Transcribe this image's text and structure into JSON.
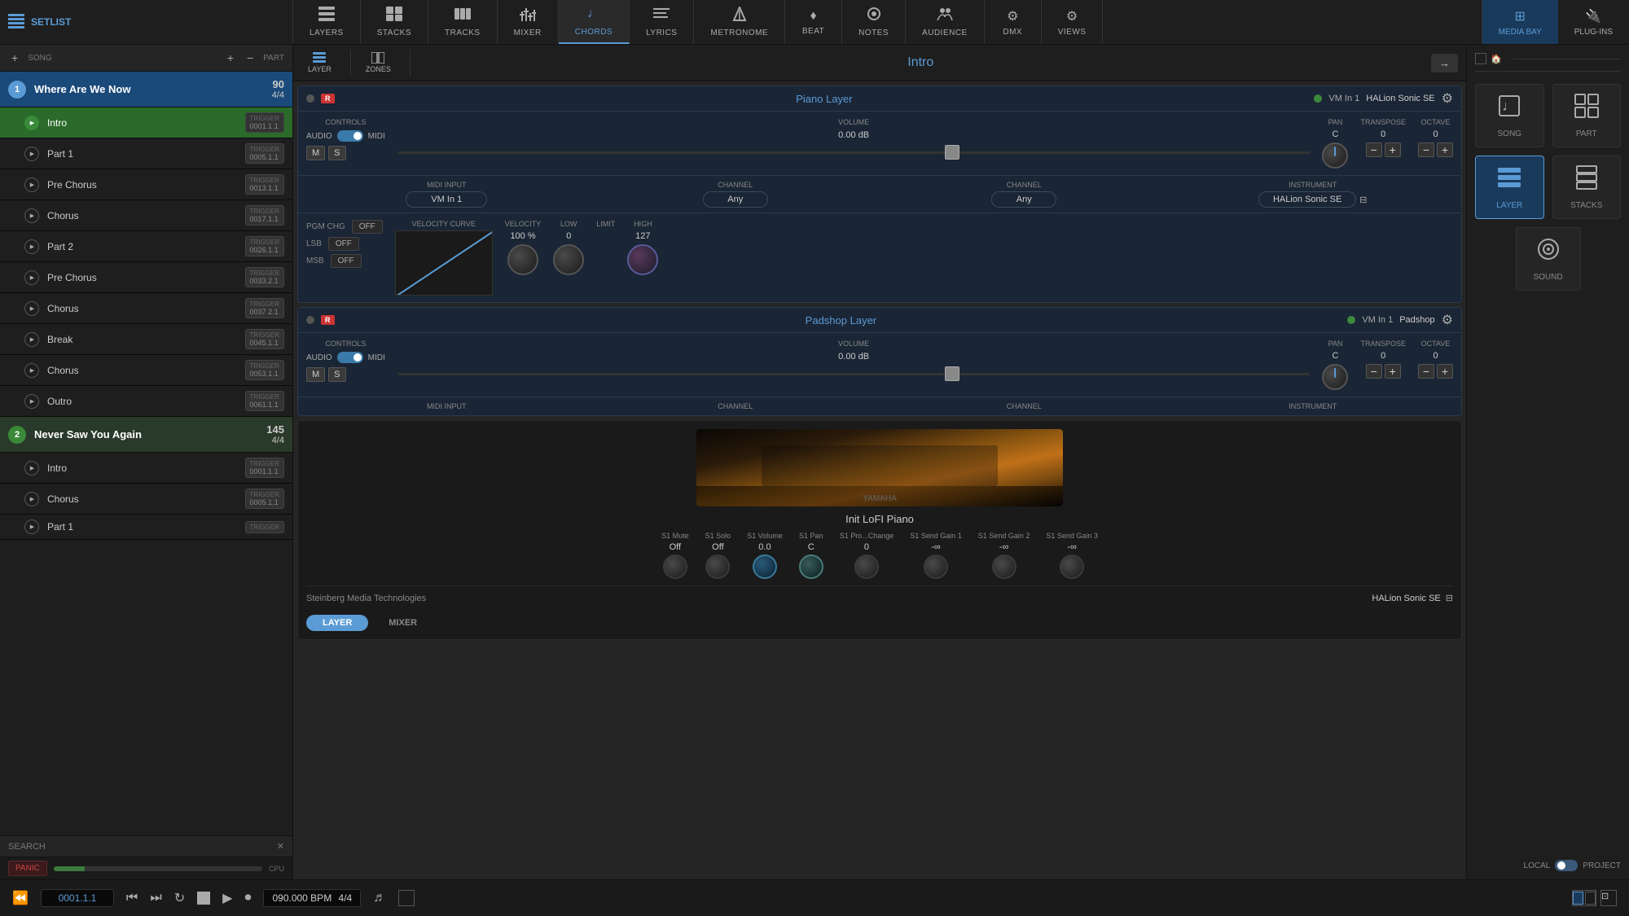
{
  "app": {
    "title": "Steinberg Media Technologies"
  },
  "topNav": {
    "setlist": "SETLIST",
    "tabs": [
      {
        "id": "layers",
        "label": "LAYERS",
        "icon": "⊞",
        "active": false
      },
      {
        "id": "stacks",
        "label": "STACKS",
        "icon": "⧉",
        "active": false
      },
      {
        "id": "tracks",
        "label": "TRACKS",
        "icon": "⊟",
        "active": false
      },
      {
        "id": "mixer",
        "label": "MIXER",
        "icon": "⊞",
        "active": false
      },
      {
        "id": "chords",
        "label": "CHORDS",
        "icon": "♩",
        "active": false
      },
      {
        "id": "lyrics",
        "label": "LYRICS",
        "icon": "≡",
        "active": false
      },
      {
        "id": "metronome",
        "label": "METRONOME",
        "icon": "🎵",
        "active": false
      },
      {
        "id": "beat",
        "label": "BEAT",
        "icon": "♦",
        "active": false
      },
      {
        "id": "notes",
        "label": "NOTES",
        "icon": "👤",
        "active": false
      },
      {
        "id": "audience",
        "label": "AUDIENCE",
        "icon": "👥",
        "active": false
      },
      {
        "id": "dmx",
        "label": "DMX",
        "icon": "⚙",
        "active": false
      },
      {
        "id": "views",
        "label": "VIEWS",
        "icon": "⚙",
        "active": false
      }
    ],
    "mediaBay": "MEDIA BAY",
    "plugIns": "PLUG-INS"
  },
  "sidebar": {
    "addSongLabel": "+",
    "addPartLabel": "+",
    "removeSongLabel": "−",
    "removePartLabel": "−",
    "songLabel": "SONG",
    "partLabel": "PART",
    "songs": [
      {
        "id": 1,
        "number": "1",
        "title": "Where Are We Now",
        "bpm": "90",
        "time": "4/4",
        "active": true,
        "parts": [
          {
            "name": "Intro",
            "trigger": "0001.1.1",
            "active": true
          },
          {
            "name": "Part 1",
            "trigger": "0005.1.1",
            "active": false
          },
          {
            "name": "Pre Chorus",
            "trigger": "0013.1.1",
            "active": false
          },
          {
            "name": "Chorus",
            "trigger": "0017.1.1",
            "active": false
          },
          {
            "name": "Part 2",
            "trigger": "0026.1.1",
            "active": false
          },
          {
            "name": "Pre Chorus",
            "trigger": "0033.2.1",
            "active": false
          },
          {
            "name": "Chorus",
            "trigger": "0037.2.1",
            "active": false
          },
          {
            "name": "Break",
            "trigger": "0045.1.1",
            "active": false
          },
          {
            "name": "Chorus",
            "trigger": "0053.1.1",
            "active": false
          },
          {
            "name": "Outro",
            "trigger": "0061.1.1",
            "active": false
          }
        ]
      },
      {
        "id": 2,
        "number": "2",
        "title": "Never Saw You Again",
        "bpm": "145",
        "time": "4/4",
        "active": false,
        "parts": [
          {
            "name": "Intro",
            "trigger": "0001.1.1",
            "active": false
          },
          {
            "name": "Chorus",
            "trigger": "0005.1.1",
            "active": false
          },
          {
            "name": "Part 1",
            "trigger": "",
            "active": false
          }
        ]
      }
    ],
    "searchLabel": "SEARCH",
    "panicLabel": "PANIC",
    "cpuLabel": "CPU"
  },
  "centerPanel": {
    "layerLabel": "LAYER",
    "zonesLabel": "ZONES",
    "sectionName": "Intro",
    "layers": [
      {
        "name": "Piano Layer",
        "rBtn": "R",
        "statusColor": "#3a8a3a",
        "vmInput": "VM In 1",
        "instrument": "HALion Sonic SE",
        "controls": {
          "audioLabel": "AUDIO",
          "midiLabel": "MIDI",
          "volumeLabel": "VOLUME",
          "volumeValue": "0.00 dB",
          "panLabel": "PAN",
          "panValue": "C",
          "transposeLabel": "TRANSPOSE",
          "transposeValue": "0",
          "octaveLabel": "OCTAVE",
          "octaveValue": "0"
        },
        "midiInput": {
          "midiInputLabel": "MIDI INPUT",
          "midiInputValue": "VM In 1",
          "channelLabel": "CHANNEL",
          "channelValue": "Any",
          "channel2Label": "CHANNEL",
          "channel2Value": "Any",
          "instrumentLabel": "INSTRUMENT",
          "instrumentValue": "HALion Sonic SE"
        },
        "pgm": {
          "pgmChgLabel": "PGM CHG",
          "pgmChgValue": "OFF",
          "lsbLabel": "LSB",
          "lsbValue": "OFF",
          "msbLabel": "MSB",
          "msbValue": "OFF"
        },
        "velocity": {
          "curvLabel": "VELOCITY CURVE",
          "velocityLabel": "VELOCITY",
          "velocityValue": "100 %",
          "lowLabel": "LOW",
          "lowValue": "0",
          "limitLabel": "LIMIT",
          "highLabel": "HIGH",
          "highValue": "127"
        }
      },
      {
        "name": "Padshop Layer",
        "rBtn": "R",
        "statusColor": "#3a8a3a",
        "vmInput": "VM In 1",
        "instrument": "Padshop",
        "controls": {
          "audioLabel": "AUDIO",
          "midiLabel": "MIDI",
          "volumeLabel": "VOLUME",
          "volumeValue": "0.00 dB",
          "panLabel": "PAN",
          "panValue": "C",
          "transposeLabel": "TRANSPOSE",
          "transposeValue": "0",
          "octaveLabel": "OCTAVE",
          "octaveValue": "0"
        },
        "midiInput": {
          "midiInputLabel": "MIDI INPUT",
          "midiInputValue": "",
          "channelLabel": "CHANNEL",
          "channelValue": "",
          "channel2Label": "CHANNEL",
          "channel2Value": "",
          "instrumentLabel": "INSTRUMENT",
          "instrumentValue": ""
        }
      }
    ],
    "instrumentPreview": {
      "name": "Init LoFI Piano",
      "brandLabel": "YAMAHA",
      "params": [
        {
          "label": "S1 Mute",
          "value": "Off"
        },
        {
          "label": "S1 Solo",
          "value": "Off"
        },
        {
          "label": "S1 Volume",
          "value": "0.0"
        },
        {
          "label": "S1 Pan",
          "value": "C"
        },
        {
          "label": "S1 Pro...Change",
          "value": "0"
        },
        {
          "label": "S1 Send Gain 1",
          "value": "-∞"
        },
        {
          "label": "S1 Send Gain 2",
          "value": "-∞"
        },
        {
          "label": "S1 Send Gain 3",
          "value": "-∞"
        }
      ]
    },
    "layerMixerTabs": {
      "layerTab": "LAYER",
      "mixerTab": "MIXER"
    },
    "footer": {
      "company": "Steinberg Media Technologies",
      "plugin": "HALion Sonic SE"
    }
  },
  "transport": {
    "position": "0001.1.1",
    "bpm": "090.000 BPM",
    "timeSignature": "4/4"
  },
  "rightPanel": {
    "items": [
      {
        "id": "song",
        "label": "SONG",
        "icon": "♩",
        "active": false
      },
      {
        "id": "part",
        "label": "PART",
        "icon": "⊞",
        "active": false
      },
      {
        "id": "layer",
        "label": "LAYER",
        "icon": "⊟",
        "active": true
      },
      {
        "id": "stacks",
        "label": "STACKS",
        "icon": "⧉",
        "active": false
      },
      {
        "id": "sound",
        "label": "SOUND",
        "icon": "◉",
        "active": false
      }
    ],
    "localLabel": "LOCAL",
    "projectLabel": "PROJECT"
  }
}
